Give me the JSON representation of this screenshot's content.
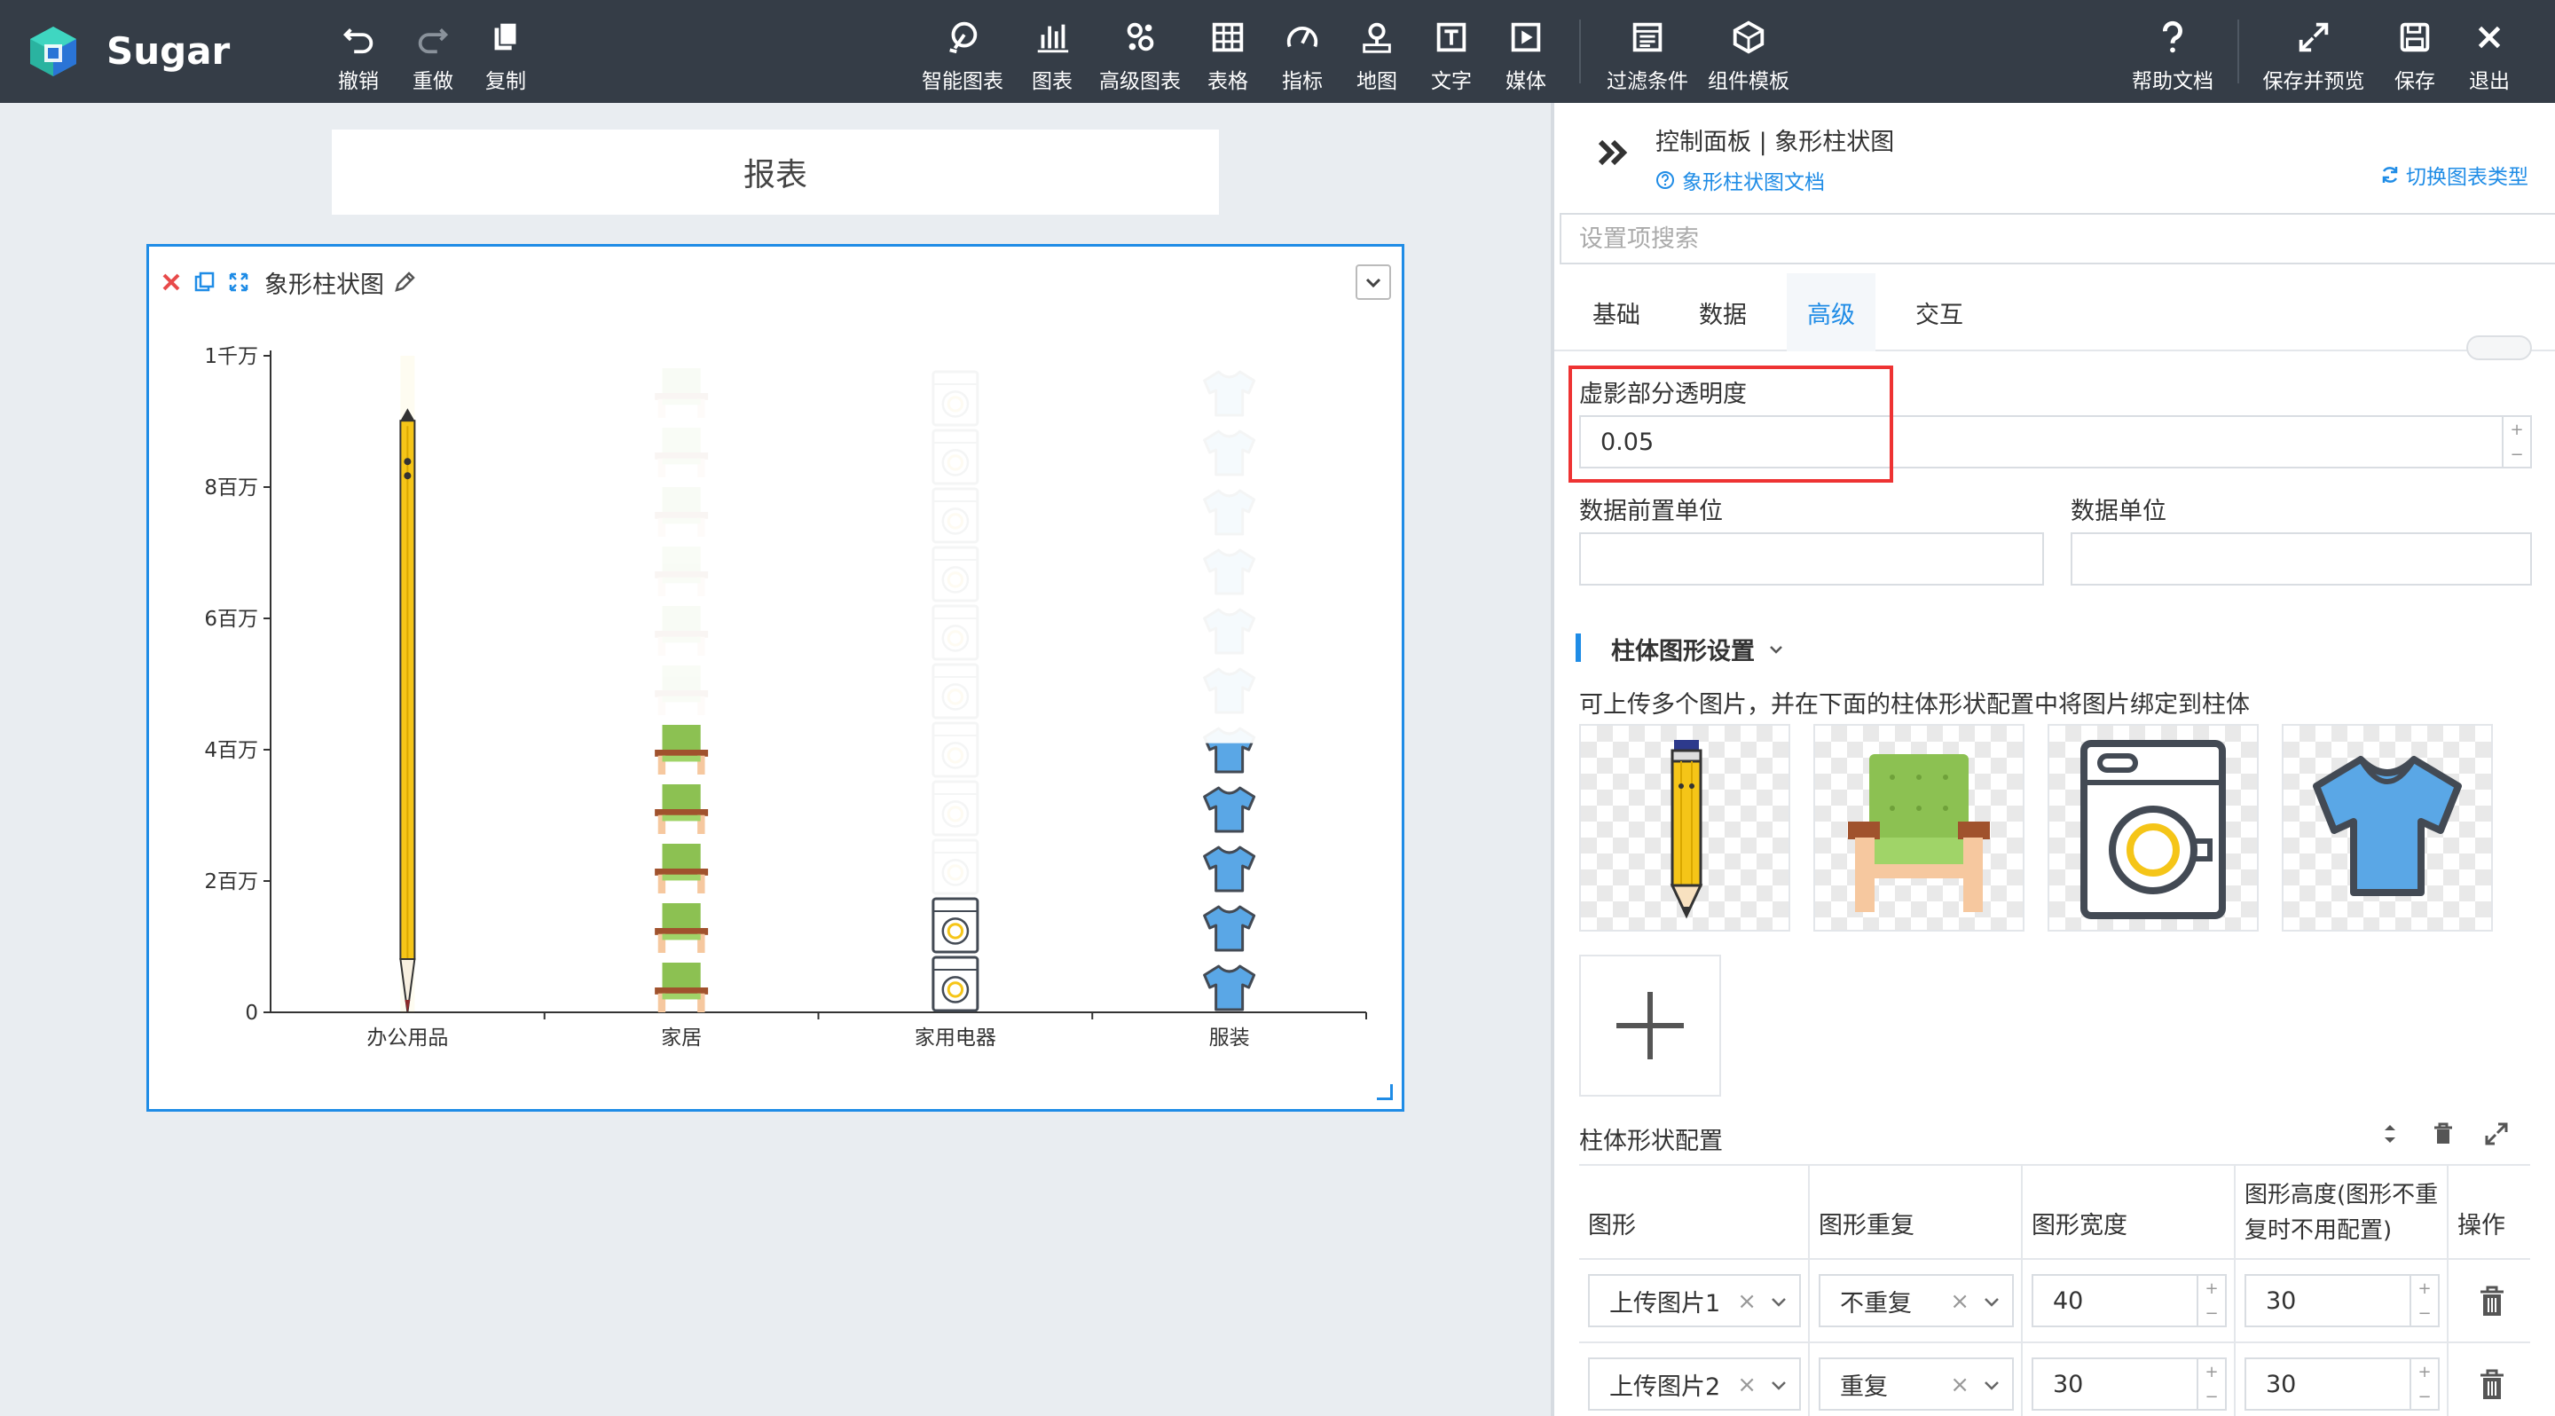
{
  "app": {
    "brand": "Sugar"
  },
  "toolbar": {
    "undo": "撤销",
    "redo": "重做",
    "copy": "复制",
    "smart_chart": "智能图表",
    "chart": "图表",
    "adv_chart": "高级图表",
    "table": "表格",
    "indicator": "指标",
    "map": "地图",
    "text": "文字",
    "media": "媒体",
    "filter": "过滤条件",
    "template": "组件模板",
    "help": "帮助文档",
    "save_preview": "保存并预览",
    "save": "保存",
    "exit": "退出"
  },
  "canvas": {
    "report_title": "报表",
    "widget_title": "象形柱状图"
  },
  "chart_data": {
    "type": "bar",
    "categories": [
      "办公用品",
      "家居",
      "家用电器",
      "服装"
    ],
    "values": [
      9200000,
      4600000,
      2500000,
      4100000
    ],
    "ylim": [
      0,
      10000000
    ],
    "ytick_values": [
      0,
      2000000,
      4000000,
      6000000,
      8000000,
      10000000
    ],
    "ytick_labels": [
      "0",
      "2百万",
      "4百万",
      "6百万",
      "8百万",
      "1千万"
    ],
    "symbols": [
      "pencil",
      "armchair",
      "washer",
      "tshirt"
    ],
    "symbol_repeat": [
      false,
      true,
      true,
      true
    ],
    "grid": false,
    "colors": {
      "pencil": "#f5c518",
      "armchair": "#8cc152",
      "washer": "#f5c518",
      "tshirt": "#5aa7e6"
    }
  },
  "panel": {
    "title": "控制面板 | 象形柱状图",
    "doc_link": "象形柱状图文档",
    "switch_type": "切换图表类型",
    "search_placeholder": "设置项搜索",
    "tabs": [
      {
        "label": "基础"
      },
      {
        "label": "数据"
      },
      {
        "label": "高级"
      },
      {
        "label": "交互"
      }
    ],
    "active_tab": "高级",
    "ghost_opacity_label": "虚影部分透明度",
    "ghost_opacity_value": "0.05",
    "prefix_unit_label": "数据前置单位",
    "unit_label": "数据单位",
    "section_title": "柱体图形设置",
    "section_desc": "可上传多个图片，并在下面的柱体形状配置中将图片绑定到柱体",
    "config_title": "柱体形状配置",
    "table_headers": [
      "图形",
      "图形重复",
      "图形宽度",
      "图形高度(图形不重复时不用配置)",
      "操作"
    ],
    "rows": [
      {
        "shape": "上传图片1",
        "repeat": "不重复",
        "width": "40",
        "height": "30"
      },
      {
        "shape": "上传图片2",
        "repeat": "重复",
        "width": "30",
        "height": "30"
      }
    ]
  },
  "colors": {
    "accent": "#1f8ce6",
    "topbar": "#353d47",
    "highlight": "#e33333"
  }
}
